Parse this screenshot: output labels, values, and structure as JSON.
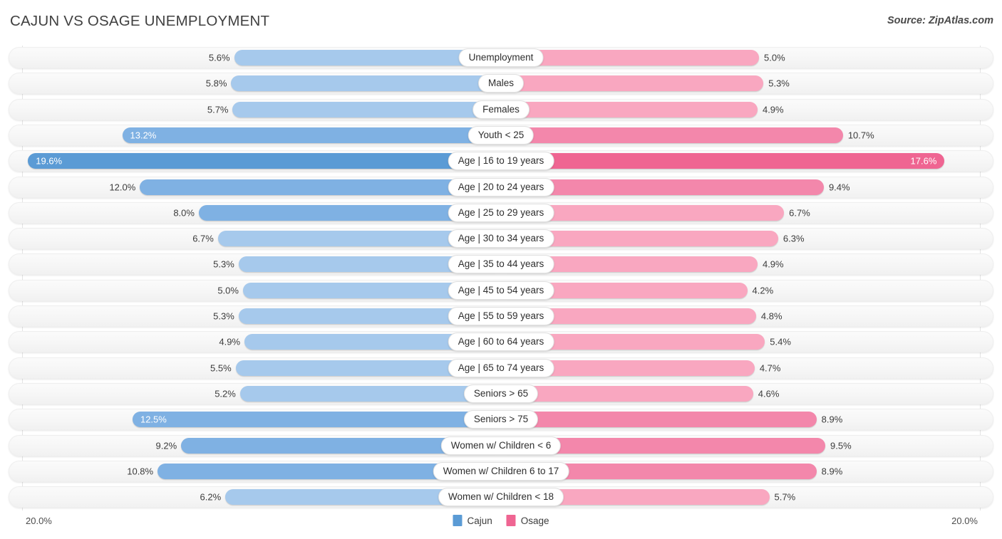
{
  "header": {
    "title": "CAJUN VS OSAGE UNEMPLOYMENT",
    "source": "Source: ZipAtlas.com"
  },
  "footer": {
    "axis_left": "20.0%",
    "axis_right": "20.0%",
    "legend": [
      {
        "label": "Cajun",
        "color": "#5b9bd5",
        "icon": "legend-swatch-cajun"
      },
      {
        "label": "Osage",
        "color": "#ef6592",
        "icon": "legend-swatch-osage"
      }
    ]
  },
  "colors": {
    "cajun_light": "#a6c9ec",
    "cajun_mid": "#7fb1e3",
    "cajun_dark": "#5b9bd5",
    "osage_light": "#f9a7c0",
    "osage_mid": "#f387ab",
    "osage_dark": "#ef6592",
    "track": "#f6f6f6",
    "gridline": "#e4e4e4"
  },
  "chart_data": {
    "type": "bar",
    "subtype": "diverging-bidirectional",
    "title": "CAJUN VS OSAGE UNEMPLOYMENT",
    "xlabel": "",
    "ylabel": "",
    "xlim": [
      20.0,
      20.0
    ],
    "axis_max_left": 20.0,
    "axis_max_right": 20.0,
    "unit": "%",
    "grid": true,
    "legend_position": "bottom-center",
    "series": [
      {
        "name": "Cajun",
        "side": "left",
        "color": "#5b9bd5",
        "values": [
          5.6,
          5.8,
          5.7,
          13.2,
          19.6,
          12.0,
          8.0,
          6.7,
          5.3,
          5.0,
          5.3,
          4.9,
          5.5,
          5.2,
          12.5,
          9.2,
          10.8,
          6.2
        ]
      },
      {
        "name": "Osage",
        "side": "right",
        "color": "#ef6592",
        "values": [
          5.0,
          5.3,
          4.9,
          10.7,
          17.6,
          9.4,
          6.7,
          6.3,
          4.9,
          4.2,
          4.8,
          5.4,
          4.7,
          4.6,
          8.9,
          9.5,
          8.9,
          5.7
        ]
      }
    ],
    "categories": [
      "Unemployment",
      "Males",
      "Females",
      "Youth < 25",
      "Age | 16 to 19 years",
      "Age | 20 to 24 years",
      "Age | 25 to 29 years",
      "Age | 30 to 34 years",
      "Age | 35 to 44 years",
      "Age | 45 to 54 years",
      "Age | 55 to 59 years",
      "Age | 60 to 64 years",
      "Age | 65 to 74 years",
      "Seniors > 65",
      "Seniors > 75",
      "Women w/ Children < 6",
      "Women w/ Children 6 to 17",
      "Women w/ Children < 18"
    ]
  },
  "rows": [
    {
      "label": "Unemployment",
      "left_value": 5.6,
      "left_text": "5.6%",
      "right_value": 5.0,
      "right_text": "5.0%"
    },
    {
      "label": "Males",
      "left_value": 5.8,
      "left_text": "5.8%",
      "right_value": 5.3,
      "right_text": "5.3%"
    },
    {
      "label": "Females",
      "left_value": 5.7,
      "left_text": "5.7%",
      "right_value": 4.9,
      "right_text": "4.9%"
    },
    {
      "label": "Youth < 25",
      "left_value": 13.2,
      "left_text": "13.2%",
      "right_value": 10.7,
      "right_text": "10.7%"
    },
    {
      "label": "Age | 16 to 19 years",
      "left_value": 19.6,
      "left_text": "19.6%",
      "right_value": 17.6,
      "right_text": "17.6%"
    },
    {
      "label": "Age | 20 to 24 years",
      "left_value": 12.0,
      "left_text": "12.0%",
      "right_value": 9.4,
      "right_text": "9.4%"
    },
    {
      "label": "Age | 25 to 29 years",
      "left_value": 8.0,
      "left_text": "8.0%",
      "right_value": 6.7,
      "right_text": "6.7%"
    },
    {
      "label": "Age | 30 to 34 years",
      "left_value": 6.7,
      "left_text": "6.7%",
      "right_value": 6.3,
      "right_text": "6.3%"
    },
    {
      "label": "Age | 35 to 44 years",
      "left_value": 5.3,
      "left_text": "5.3%",
      "right_value": 4.9,
      "right_text": "4.9%"
    },
    {
      "label": "Age | 45 to 54 years",
      "left_value": 5.0,
      "left_text": "5.0%",
      "right_value": 4.2,
      "right_text": "4.2%"
    },
    {
      "label": "Age | 55 to 59 years",
      "left_value": 5.3,
      "left_text": "5.3%",
      "right_value": 4.8,
      "right_text": "4.8%"
    },
    {
      "label": "Age | 60 to 64 years",
      "left_value": 4.9,
      "left_text": "4.9%",
      "right_value": 5.4,
      "right_text": "5.4%"
    },
    {
      "label": "Age | 65 to 74 years",
      "left_value": 5.5,
      "left_text": "5.5%",
      "right_value": 4.7,
      "right_text": "4.7%"
    },
    {
      "label": "Seniors > 65",
      "left_value": 5.2,
      "left_text": "5.2%",
      "right_value": 4.6,
      "right_text": "4.6%"
    },
    {
      "label": "Seniors > 75",
      "left_value": 12.5,
      "left_text": "12.5%",
      "right_value": 8.9,
      "right_text": "8.9%"
    },
    {
      "label": "Women w/ Children < 6",
      "left_value": 9.2,
      "left_text": "9.2%",
      "right_value": 9.5,
      "right_text": "9.5%"
    },
    {
      "label": "Women w/ Children 6 to 17",
      "left_value": 10.8,
      "left_text": "10.8%",
      "right_value": 8.9,
      "right_text": "8.9%"
    },
    {
      "label": "Women w/ Children < 18",
      "left_value": 6.2,
      "left_text": "6.2%",
      "right_value": 5.7,
      "right_text": "5.7%"
    }
  ]
}
